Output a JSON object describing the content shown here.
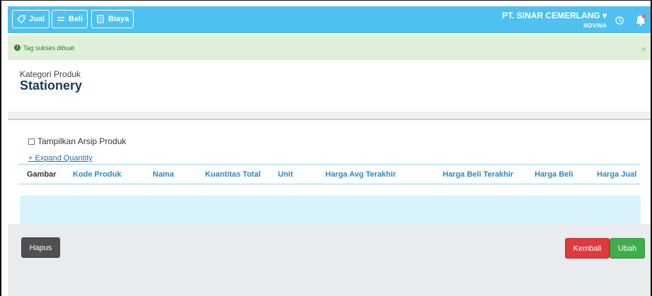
{
  "nav": {
    "jual": "Jual",
    "beli": "Beli",
    "biaya": "Biaya",
    "company": "PT. SINAR CEMERLANG ▾",
    "user": "NOVINA"
  },
  "alert": {
    "message": "Tag sukses dibuat",
    "close": "×"
  },
  "header": {
    "label": "Kategori Produk",
    "title": "Stationery"
  },
  "content": {
    "archive_label": "Tampilkan Arsip Produk",
    "expand_label": "+ Expand Quantity",
    "columns": [
      "Gambar",
      "Kode Produk",
      "Nama",
      "Kuantitas Total",
      "Unit",
      "Harga Avg Terakhir",
      "Harga Beli Terakhir",
      "Harga Beli",
      "Harga Jual"
    ]
  },
  "footer": {
    "hapus": "Hapus",
    "kembali": "Kembali",
    "ubah": "Ubah"
  },
  "colors": {
    "topbar": "#4fc1f0",
    "alert_bg": "#dff0d8",
    "title": "#1b3a5b",
    "kembali": "#e0393e",
    "ubah": "#3fae4a",
    "hapus": "#505050"
  }
}
